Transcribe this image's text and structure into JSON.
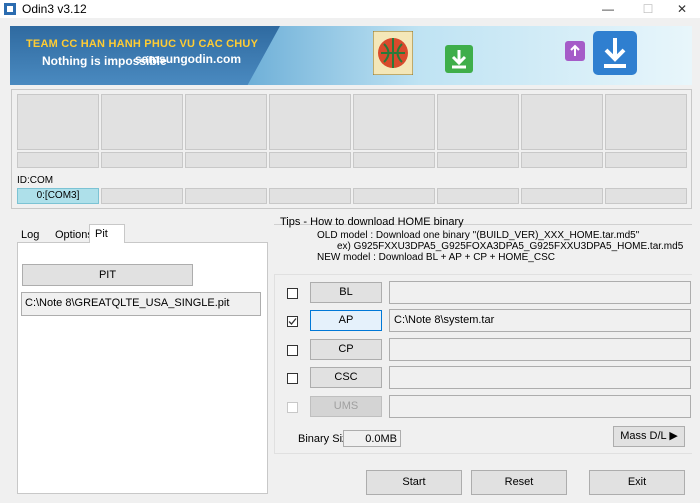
{
  "window": {
    "title": "Odin3 v3.12",
    "minimize": "—",
    "maximize": "☐",
    "close": "✕"
  },
  "banner": {
    "heading": "TEAM CC HAN HANH PHUC VU CAC CHUY",
    "tagline": "Nothing is impossible",
    "site": "samsungodin.com"
  },
  "ports": {
    "id_com_label": "ID:COM",
    "com0": "0:[COM3]"
  },
  "tabs": {
    "log": "Log",
    "options": "Options",
    "pit": "Pit"
  },
  "pit": {
    "button": "PIT",
    "path": "C:\\Note 8\\GREATQLTE_USA_SINGLE.pit"
  },
  "tips": {
    "title": "Tips - How to download HOME binary",
    "line1": "OLD model  : Download one binary    \"(BUILD_VER)_XXX_HOME.tar.md5\"",
    "line2": "ex) G925FXXU3DPA5_G925FOXA3DPA5_G925FXXU3DPA5_HOME.tar.md5",
    "line3": "NEW model : Download BL + AP + CP + HOME_CSC"
  },
  "files": [
    {
      "label": "BL",
      "checked": false,
      "path": "",
      "state": "normal"
    },
    {
      "label": "AP",
      "checked": true,
      "path": "C:\\Note 8\\system.tar",
      "state": "active"
    },
    {
      "label": "CP",
      "checked": false,
      "path": "",
      "state": "normal"
    },
    {
      "label": "CSC",
      "checked": false,
      "path": "",
      "state": "normal"
    },
    {
      "label": "UMS",
      "checked": false,
      "path": "",
      "state": "disabled"
    }
  ],
  "binary": {
    "label": "Binary Size",
    "value": "0.0MB"
  },
  "actions": {
    "mass_dl": "Mass D/L ▶",
    "start": "Start",
    "reset": "Reset",
    "exit": "Exit"
  }
}
